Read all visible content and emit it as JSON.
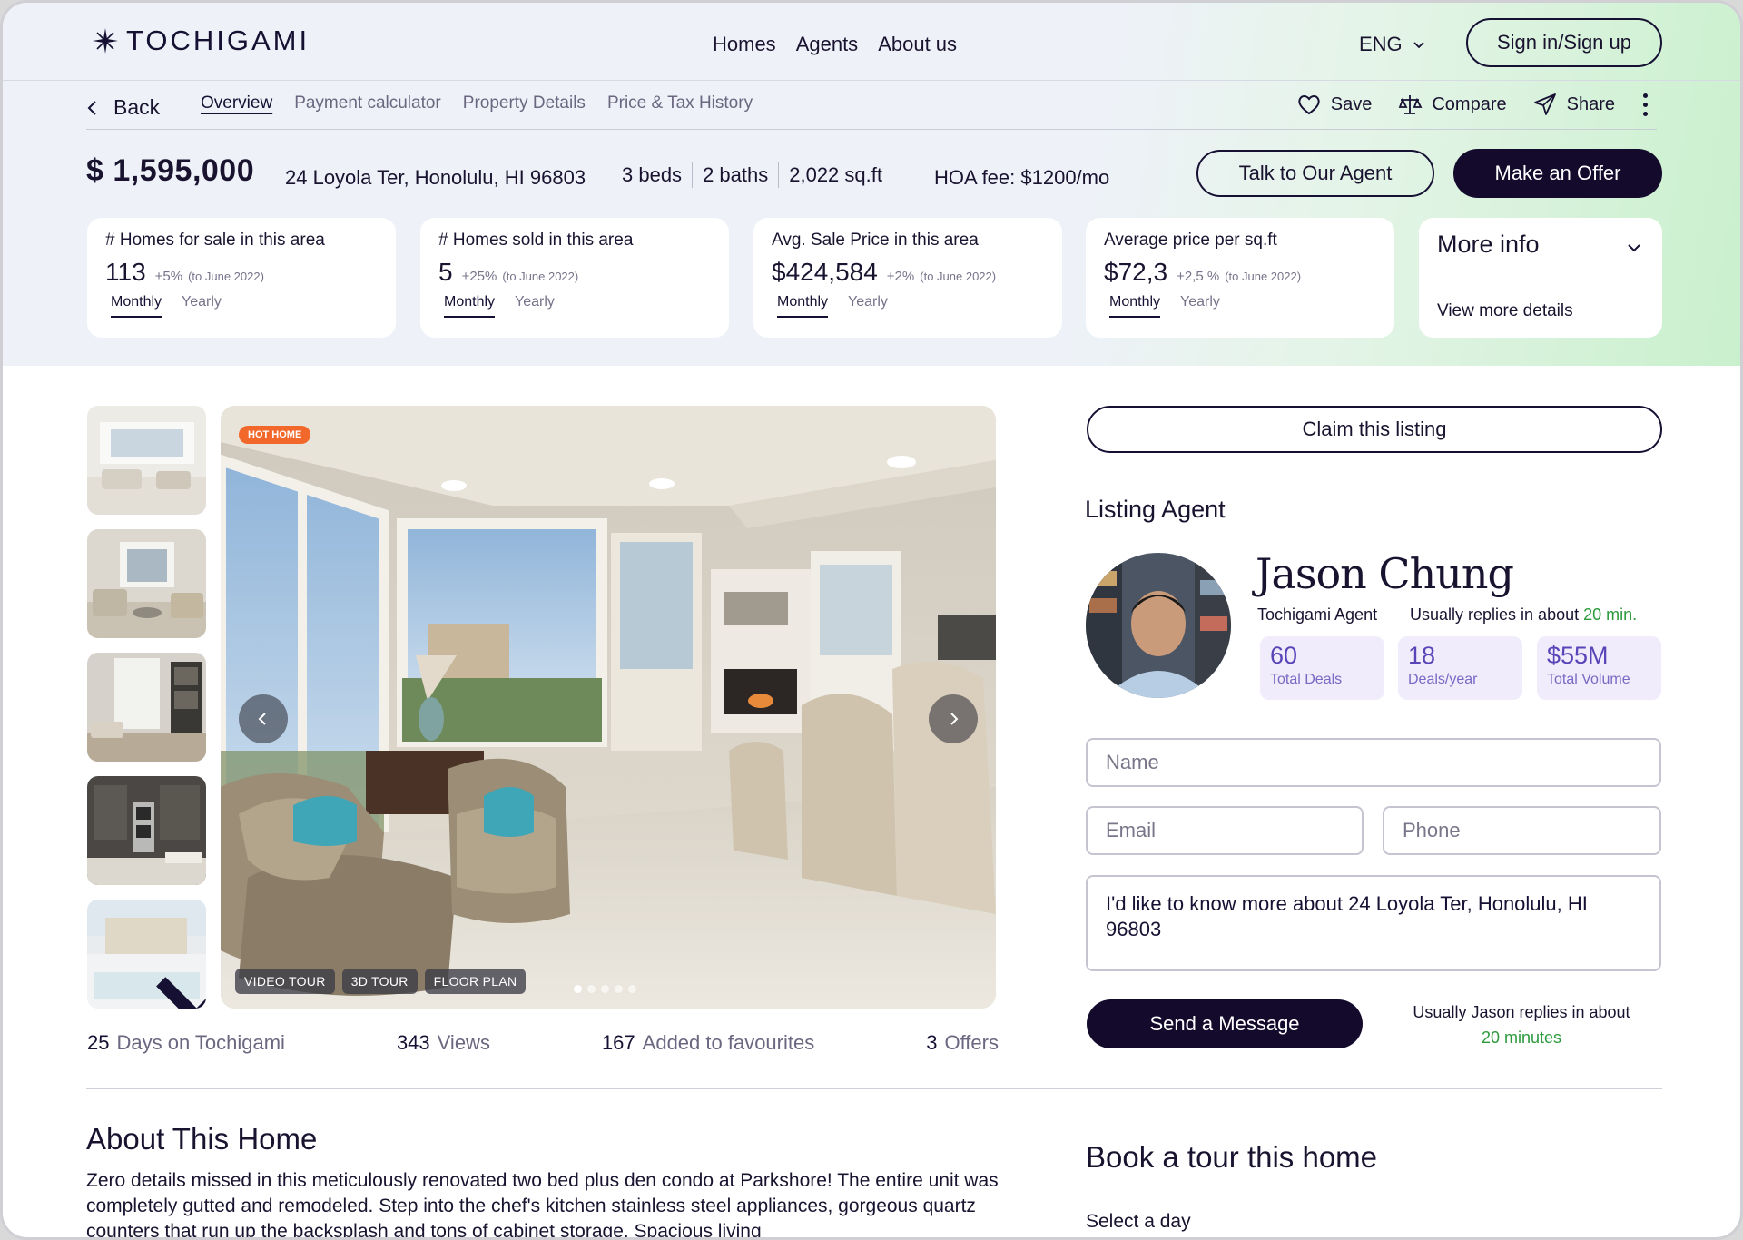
{
  "brand": {
    "name": "TOCHIGAMI"
  },
  "nav": {
    "links": [
      "Homes",
      "Agents",
      "About us"
    ],
    "language": "ENG",
    "signin_label": "Sign in/Sign up"
  },
  "subnav": {
    "back_label": "Back",
    "tabs": [
      "Overview",
      "Payment calculator",
      "Property Details",
      "Price & Tax History"
    ],
    "active_tab": "Overview",
    "actions": {
      "save": "Save",
      "compare": "Compare",
      "share": "Share"
    }
  },
  "property": {
    "price": "$ 1,595,000",
    "address": "24 Loyola Ter, Honolulu, HI 96803",
    "beds": "3 beds",
    "baths": "2 baths",
    "sqft": "2,022 sq.ft",
    "hoa": "HOA fee: $1200/mo",
    "talk_label": "Talk to Our Agent",
    "offer_label": "Make an Offer"
  },
  "stats": [
    {
      "title": "# Homes for sale in this area",
      "value": "113",
      "change": "+5%",
      "note": "(to June 2022)",
      "tab_on": "Monthly",
      "tab_off": "Yearly"
    },
    {
      "title": "# Homes sold in this area",
      "value": "5",
      "change": "+25%",
      "note": "(to June 2022)",
      "tab_on": "Monthly",
      "tab_off": "Yearly"
    },
    {
      "title": "Avg. Sale Price in this area",
      "value": "$424,584",
      "change": "+2%",
      "note": "(to June 2022)",
      "tab_on": "Monthly",
      "tab_off": "Yearly"
    },
    {
      "title": "Average price per sq.ft",
      "value": "$72,3",
      "change": "+2,5 %",
      "note": "(to June 2022)",
      "tab_on": "Monthly",
      "tab_off": "Yearly"
    }
  ],
  "more_info": {
    "title": "More info",
    "link": "View more details"
  },
  "gallery": {
    "badge": "HOT HOME",
    "tags": [
      "VIDEO TOUR",
      "3D TOUR",
      "FLOOR PLAN"
    ],
    "slide_count": 5,
    "current_slide": 1
  },
  "listing_stats": [
    {
      "n": "25",
      "label": "Days on Tochigami"
    },
    {
      "n": "343",
      "label": "Views"
    },
    {
      "n": "167",
      "label": "Added to favourites"
    },
    {
      "n": "3",
      "label": "Offers"
    }
  ],
  "agent": {
    "claim_label": "Claim this listing",
    "heading": "Listing Agent",
    "name": "Jason Chung",
    "title": "Tochigami Agent",
    "replies_prefix": "Usually replies in about",
    "replies_time": "20 min.",
    "stats": [
      {
        "v": "60",
        "k": "Total Deals"
      },
      {
        "v": "18",
        "k": "Deals/year"
      },
      {
        "v": "$55M",
        "k": "Total Volume"
      }
    ]
  },
  "form": {
    "name_placeholder": "Name",
    "email_placeholder": "Email",
    "phone_placeholder": "Phone",
    "message": "I'd like to know more about 24 Loyola Ter, Honolulu, HI 96803",
    "send_label": "Send a Message",
    "note_prefix": "Usually Jason replies in about",
    "note_time": "20 minutes"
  },
  "about": {
    "heading": "About This Home",
    "text": "Zero details missed in this meticulously renovated two bed plus den condo at Parkshore! The entire unit was completely gutted and remodeled. Step into the chef's kitchen stainless steel appliances, gorgeous quartz counters that run up the backsplash and tons of cabinet storage. Spacious living"
  },
  "book": {
    "heading": "Book a tour this home",
    "select_day": "Select a day"
  },
  "colors": {
    "accent_dark": "#130a2c",
    "hot_badge": "#f2672a",
    "reply_green": "#2c9a3c",
    "stat_purple": "#5a45b8"
  }
}
